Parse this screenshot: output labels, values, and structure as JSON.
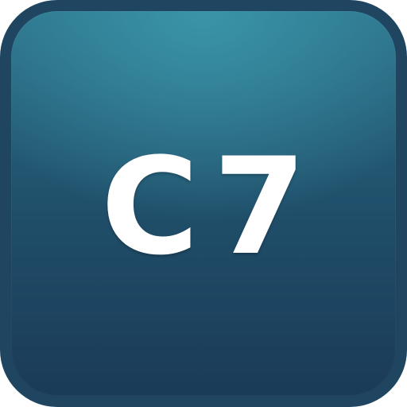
{
  "icon": {
    "label": "C7",
    "colors": {
      "outer_frame": "#1f4560",
      "face_top": "#3a94a8",
      "face_bottom": "#1b3b58",
      "text": "#ffffff"
    }
  }
}
